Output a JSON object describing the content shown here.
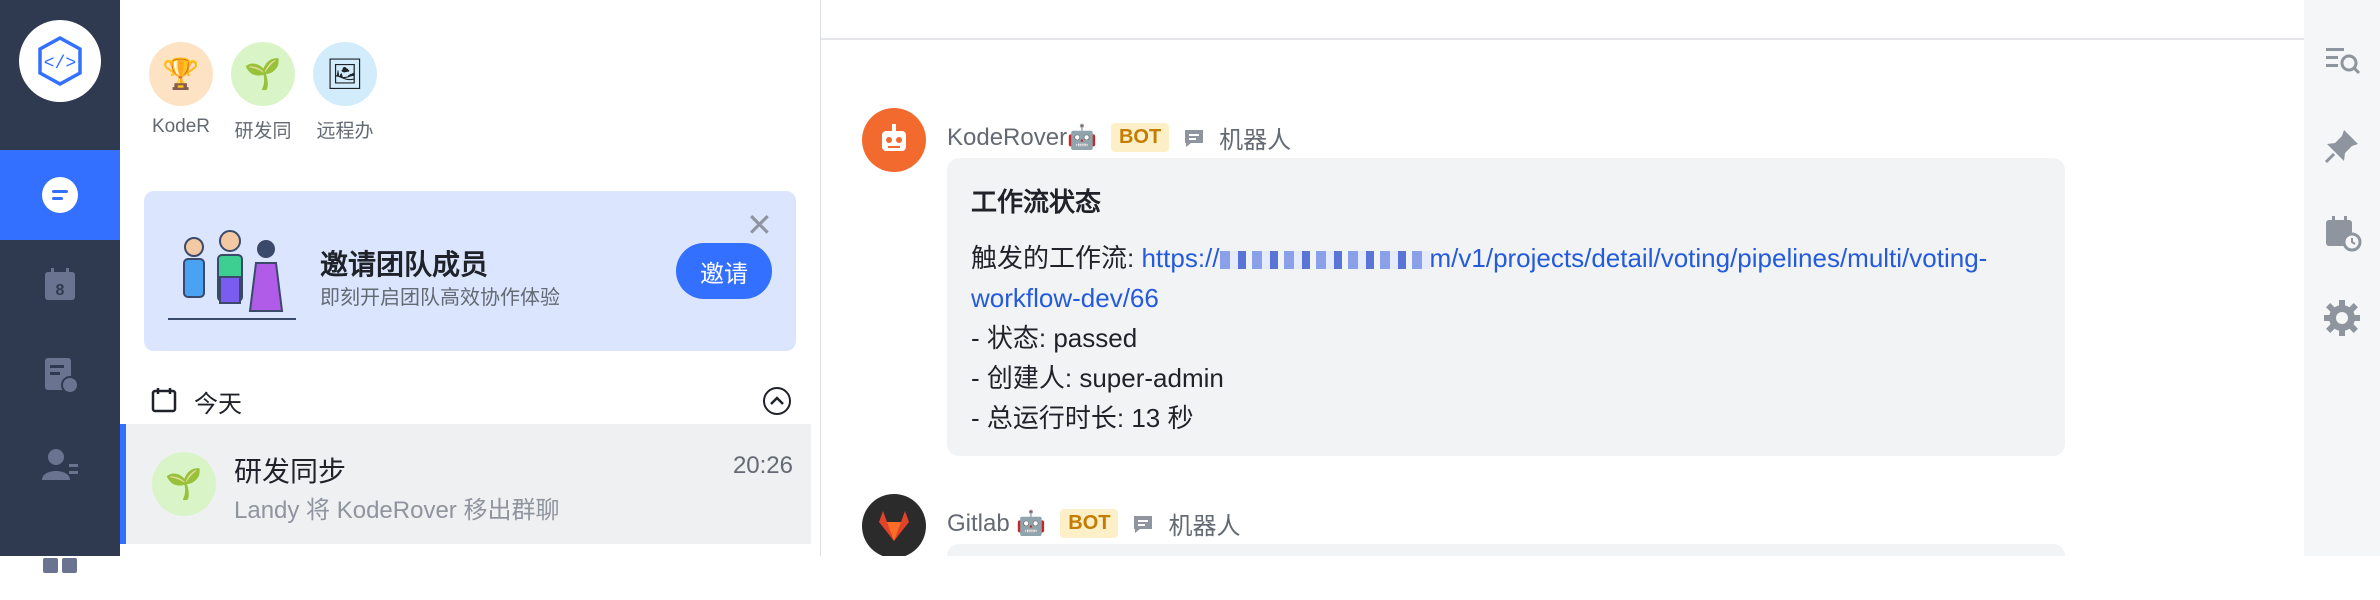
{
  "rail": {
    "items": [
      "chat-icon",
      "calendar-icon",
      "docs-icon",
      "contacts-icon",
      "apps-icon"
    ],
    "active": "chat-icon",
    "accent": "#3370ff"
  },
  "recent": [
    {
      "name": "KodeR",
      "icon": "trophy-icon",
      "color": "#fde3c3"
    },
    {
      "name": "研发同",
      "icon": "plant-icon",
      "color": "#d9f5c8"
    },
    {
      "name": "远程办",
      "icon": "picture-icon",
      "color": "#d2ecfb"
    }
  ],
  "banner": {
    "title": "邀请团队成员",
    "subtitle": "即刻开启团队高效协作体验",
    "button": "邀请"
  },
  "today": {
    "label": "今天"
  },
  "chat": {
    "title": "研发同步",
    "time": "20:26",
    "preview": "Landy 将 KodeRover 移出群聊"
  },
  "messages": {
    "m1": {
      "sender": "KodeRover🤖",
      "badge": "BOT",
      "robot": "机器人",
      "card": {
        "title": "工作流状态",
        "link_prefix": "触发的工作流: ",
        "link_a": "https://",
        "link_b": "m/v1/projects/detail/voting/pipelines/multi/voting-workflow-dev/66",
        "status": "- 状态: passed",
        "creator": "- 创建人:  super-admin",
        "duration": "- 总运行时长:  13 秒"
      }
    },
    "m2": {
      "sender": "Gitlab 🤖",
      "badge": "BOT",
      "robot": "机器人"
    }
  },
  "rightbar": [
    "search-list-icon",
    "pin-icon",
    "schedule-icon",
    "settings-icon"
  ]
}
